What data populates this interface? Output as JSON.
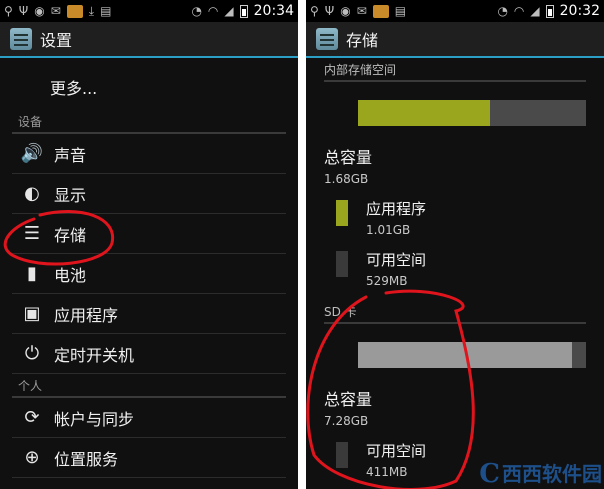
{
  "left": {
    "status": {
      "time": "20:34"
    },
    "action_bar": {
      "title": "设置"
    },
    "more": "更多...",
    "section_device": "设备",
    "items_device": [
      {
        "label": "声音",
        "icon": "speaker-icon"
      },
      {
        "label": "显示",
        "icon": "brightness-icon"
      },
      {
        "label": "存储",
        "icon": "storage-icon"
      },
      {
        "label": "电池",
        "icon": "battery-icon"
      },
      {
        "label": "应用程序",
        "icon": "apps-icon"
      },
      {
        "label": "定时开关机",
        "icon": "power-icon"
      }
    ],
    "section_personal": "个人",
    "items_personal": [
      {
        "label": "帐户与同步",
        "icon": "sync-icon"
      },
      {
        "label": "位置服务",
        "icon": "location-icon"
      }
    ]
  },
  "right": {
    "status": {
      "time": "20:32"
    },
    "action_bar": {
      "title": "存储"
    },
    "internal": {
      "section": "内部存储空间",
      "used_fraction": 0.58,
      "used_color": "#9aa61d",
      "total_label": "总容量",
      "total_value": "1.68GB",
      "apps_label": "应用程序",
      "apps_value": "1.01GB",
      "free_label": "可用空间",
      "free_value": "529MB"
    },
    "sd": {
      "section": "SD 卡",
      "used_fraction": 0.94,
      "used_color": "#9a9a9a",
      "total_label": "总容量",
      "total_value": "7.28GB",
      "free_label": "可用空间",
      "free_value": "411MB"
    }
  },
  "watermark": {
    "text": "西西软件园"
  },
  "colors": {
    "accent": "#2b9fc6",
    "annotation": "#e0141c"
  }
}
